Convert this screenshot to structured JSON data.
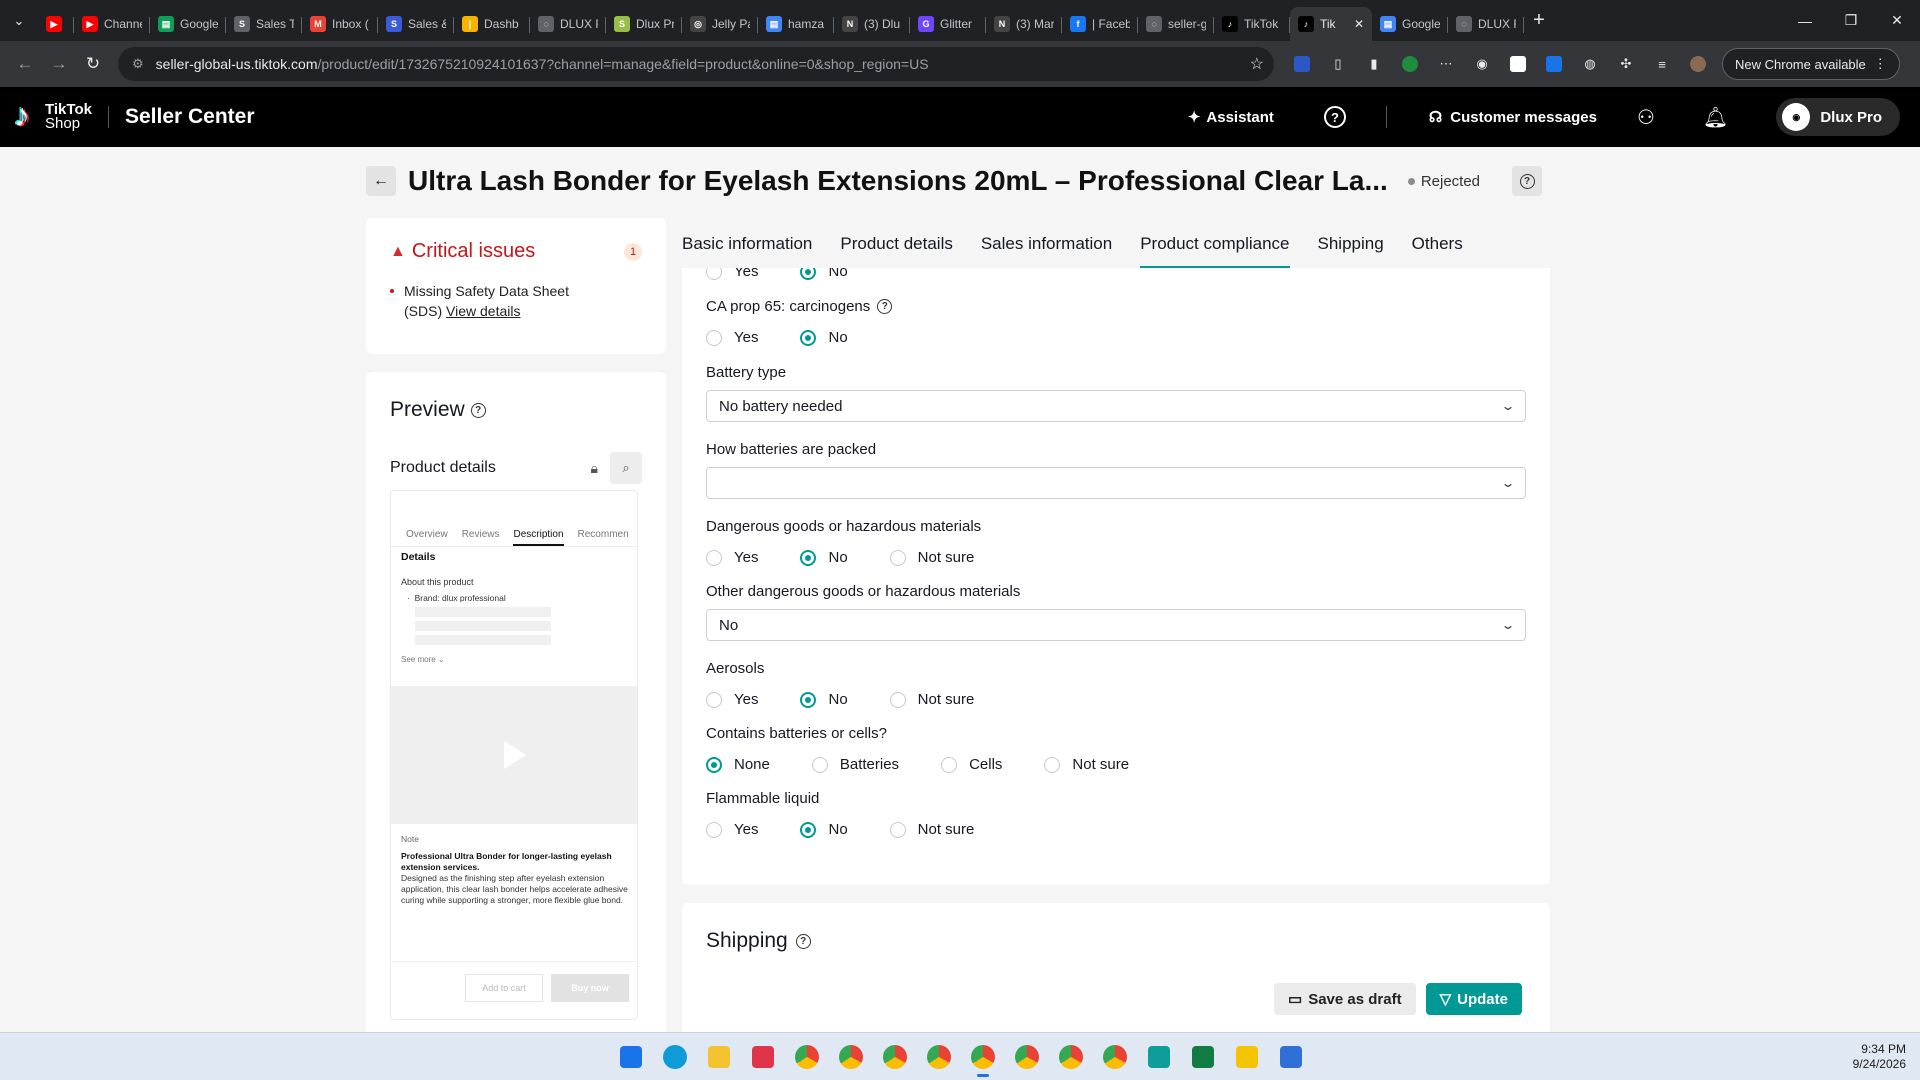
{
  "browser": {
    "tabs": [
      {
        "title": "",
        "fav_color": "#ff0000",
        "fav_glyph": "▶"
      },
      {
        "title": "Channe",
        "fav_color": "#ff0000",
        "fav_glyph": "▶"
      },
      {
        "title": "Google",
        "fav_color": "#0f9d58",
        "fav_glyph": "▤"
      },
      {
        "title": "Sales T",
        "fav_color": "#5f6368",
        "fav_glyph": "S"
      },
      {
        "title": "Inbox (",
        "fav_color": "#ea4335",
        "fav_glyph": "M"
      },
      {
        "title": "Sales &",
        "fav_color": "#3b5bdb",
        "fav_glyph": "S"
      },
      {
        "title": "Dashb",
        "fav_color": "#f4b400",
        "fav_glyph": "|"
      },
      {
        "title": "DLUX F",
        "fav_color": "#5f6368",
        "fav_glyph": "◌"
      },
      {
        "title": "Dlux Pr",
        "fav_color": "#96bf48",
        "fav_glyph": "S"
      },
      {
        "title": "Jelly Pa",
        "fav_color": "#444444",
        "fav_glyph": "◎"
      },
      {
        "title": "hamza",
        "fav_color": "#4285f4",
        "fav_glyph": "▤"
      },
      {
        "title": "(3) Dlu",
        "fav_color": "#444444",
        "fav_glyph": "N"
      },
      {
        "title": "Glitter",
        "fav_color": "#6c47ff",
        "fav_glyph": "G"
      },
      {
        "title": "(3) Mar",
        "fav_color": "#444444",
        "fav_glyph": "N"
      },
      {
        "title": "| Faceb",
        "fav_color": "#1877f2",
        "fav_glyph": "f"
      },
      {
        "title": "seller-g",
        "fav_color": "#5f6368",
        "fav_glyph": "◌"
      },
      {
        "title": "TikTok",
        "fav_color": "#000000",
        "fav_glyph": "♪"
      },
      {
        "title": "Tik",
        "fav_color": "#000000",
        "fav_glyph": "♪",
        "active": true
      },
      {
        "title": "Google",
        "fav_color": "#4285f4",
        "fav_glyph": "▤"
      },
      {
        "title": "DLUX F",
        "fav_color": "#5f6368",
        "fav_glyph": "◌"
      }
    ],
    "url_host": "seller-global-us.tiktok.com",
    "url_path": "/product/edit/1732675210924101637?channel=manage&field=product&online=0&shop_region=US",
    "new_chrome_label": "New Chrome available"
  },
  "header": {
    "logo_line1": "TikTok",
    "logo_line2": "Shop",
    "app_name": "Seller Center",
    "assistant_label": "Assistant",
    "customer_messages_label": "Customer messages",
    "account_name": "Dlux Pro"
  },
  "product": {
    "title": "Ultra Lash Bonder for Eyelash Extensions 20mL – Professional Clear La...",
    "status": "Rejected"
  },
  "issues": {
    "title": "Critical issues",
    "count": "1",
    "item_text": "Missing Safety Data Sheet (SDS)",
    "item_link": "View details"
  },
  "preview": {
    "title": "Preview",
    "product_details_label": "Product details",
    "phone_tabs": [
      "Overview",
      "Reviews",
      "Description",
      "Recommen"
    ],
    "details": "Details",
    "about": "About this product",
    "brand": "Brand: dlux professional",
    "see_more": "See more",
    "note_label": "Note",
    "note_bold": "Professional Ultra Bonder for longer-lasting eyelash extension services.",
    "note_body": "Designed as the finishing step after eyelash extension application, this clear lash bonder helps accelerate adhesive curing while supporting a stronger, more flexible glue bond.",
    "add_to_cart": "Add to cart",
    "buy_now": "Buy now"
  },
  "section_tabs": [
    "Basic information",
    "Product details",
    "Sales information",
    "Product compliance",
    "Shipping",
    "Others"
  ],
  "compliance": {
    "q0": {
      "options": [
        "Yes",
        "No"
      ],
      "selected": "No"
    },
    "q1": {
      "label": "CA prop 65: carcinogens",
      "options": [
        "Yes",
        "No"
      ],
      "selected": "No"
    },
    "battery_type": {
      "label": "Battery type",
      "value": "No battery needed"
    },
    "batteries_packed": {
      "label": "How batteries are packed",
      "value": ""
    },
    "q_dangerous": {
      "label": "Dangerous goods or hazardous materials",
      "options": [
        "Yes",
        "No",
        "Not sure"
      ],
      "selected": "No"
    },
    "other_dangerous": {
      "label": "Other dangerous goods or hazardous materials",
      "value": "No"
    },
    "q_aerosols": {
      "label": "Aerosols",
      "options": [
        "Yes",
        "No",
        "Not sure"
      ],
      "selected": "No"
    },
    "q_batteries": {
      "label": "Contains batteries or cells?",
      "options": [
        "None",
        "Batteries",
        "Cells",
        "Not sure"
      ],
      "selected": "None"
    },
    "q_flammable": {
      "label": "Flammable liquid",
      "options": [
        "Yes",
        "No",
        "Not sure"
      ],
      "selected": "No"
    }
  },
  "shipping": {
    "title": "Shipping"
  },
  "actions": {
    "save_draft": "Save as draft",
    "update": "Update"
  },
  "taskbar": {
    "apps": [
      {
        "name": "start",
        "color": "#1a73e8"
      },
      {
        "name": "edge",
        "color": "#0f9bd7"
      },
      {
        "name": "explorer",
        "color": "#f4c430"
      },
      {
        "name": "snipping",
        "color": "#e0344b"
      },
      {
        "name": "chrome",
        "color": "#34a853"
      },
      {
        "name": "chrome",
        "color": "#4285f4"
      },
      {
        "name": "chrome",
        "color": "#ea4335"
      },
      {
        "name": "chrome",
        "color": "#db4437"
      },
      {
        "name": "chrome",
        "color": "#4285f4",
        "active": true
      },
      {
        "name": "chrome",
        "color": "#ea4335"
      },
      {
        "name": "chrome",
        "color": "#fbbc05"
      },
      {
        "name": "chrome",
        "color": "#ea4335"
      },
      {
        "name": "app",
        "color": "#0f9d9a"
      },
      {
        "name": "excel",
        "color": "#107c41"
      },
      {
        "name": "chat",
        "color": "#f5c400"
      },
      {
        "name": "photos",
        "color": "#2f6fd6"
      }
    ],
    "time": "9:34 PM",
    "date": "9/24/2026"
  }
}
